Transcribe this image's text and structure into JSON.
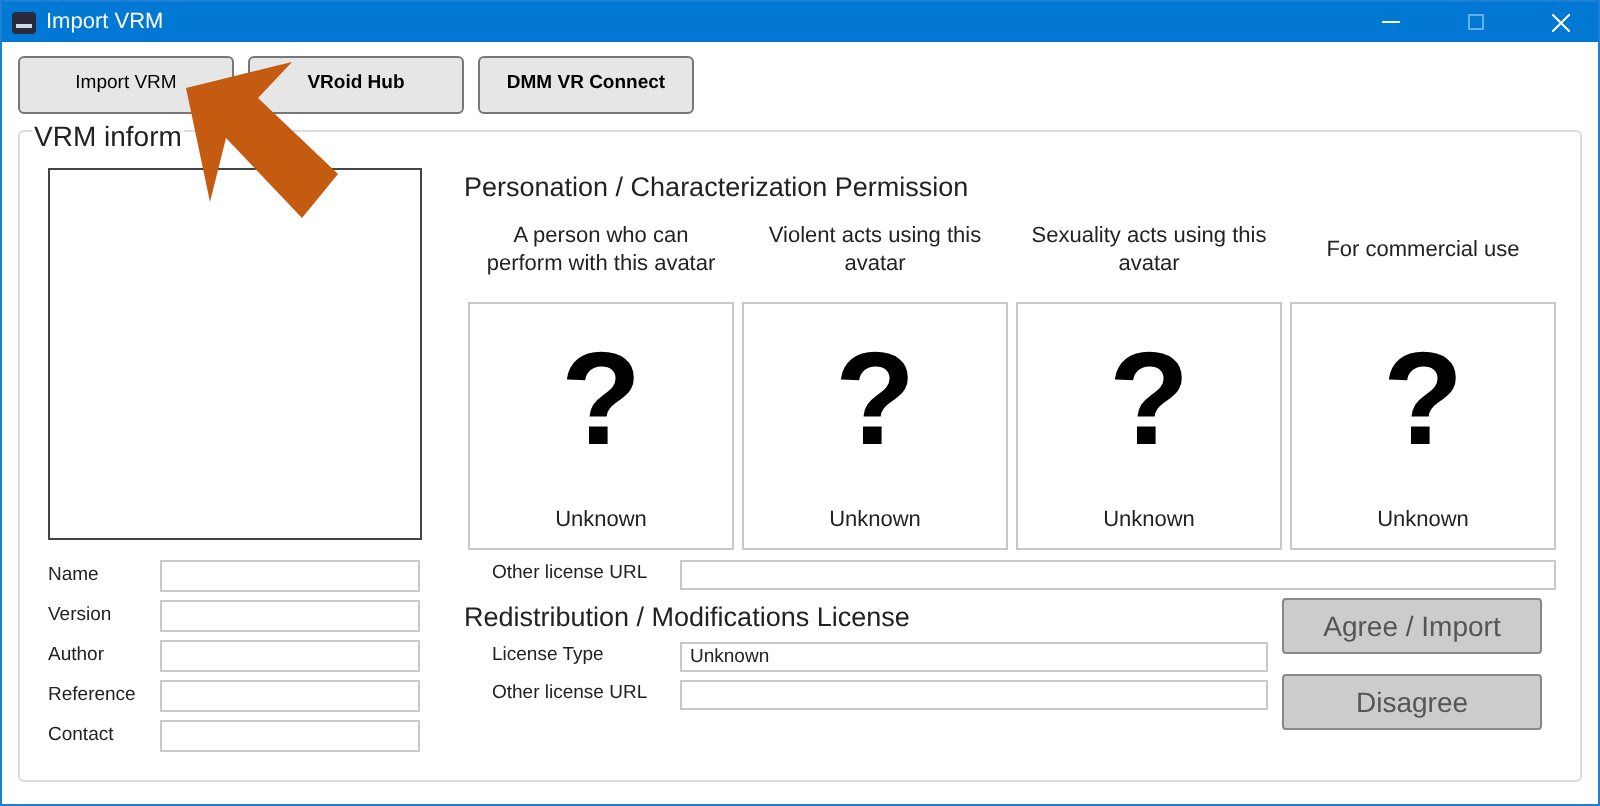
{
  "window": {
    "title": "Import VRM"
  },
  "source_buttons": [
    {
      "label": "Import VRM",
      "bold": false
    },
    {
      "label": "VRoid Hub",
      "bold": true
    },
    {
      "label": "DMM VR Connect",
      "bold": true
    }
  ],
  "vrm_info": {
    "title": "VRM inform",
    "fields": [
      {
        "label": "Name"
      },
      {
        "label": "Version"
      },
      {
        "label": "Author"
      },
      {
        "label": "Reference"
      },
      {
        "label": "Contact"
      }
    ]
  },
  "permission": {
    "title": "Personation / Characterization Permission",
    "items": [
      {
        "header": "A person who can perform with this avatar",
        "mark": "?",
        "value": "Unknown"
      },
      {
        "header": "Violent acts using this avatar",
        "mark": "?",
        "value": "Unknown"
      },
      {
        "header": "Sexuality acts using this avatar",
        "mark": "?",
        "value": "Unknown"
      },
      {
        "header": "For commercial use",
        "mark": "?",
        "value": "Unknown"
      }
    ],
    "other_license_url_label": "Other license URL"
  },
  "license": {
    "title": "Redistribution / Modifications License",
    "license_type_label": "License Type",
    "license_type_value": "Unknown",
    "other_license_url_label": "Other license URL"
  },
  "actions": [
    {
      "label": "Agree / Import",
      "disabled": true
    },
    {
      "label": "Disagree",
      "disabled": true
    }
  ]
}
